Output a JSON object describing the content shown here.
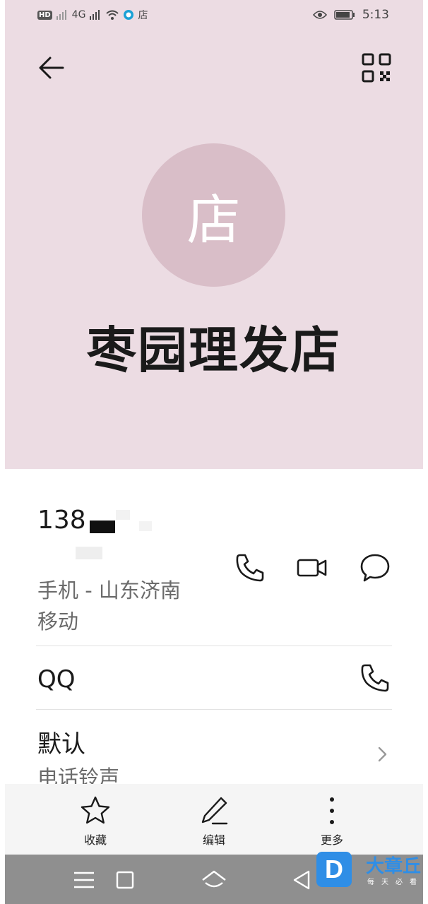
{
  "status_bar": {
    "hd_badge": "HD",
    "network": "4G",
    "notification_char": "店",
    "time": "5:13"
  },
  "contact": {
    "avatar_char": "店",
    "name": "枣园理发店"
  },
  "phone": {
    "number": "138",
    "type_line1": "手机 - 山东济南",
    "type_line2": "移动"
  },
  "qq": {
    "label": "QQ"
  },
  "ringtone": {
    "title": "默认",
    "subtitle": "电话铃声"
  },
  "bottom_actions": {
    "favorite": "收藏",
    "edit": "编辑",
    "more": "更多"
  },
  "watermark": {
    "logo_letter": "D",
    "title": "大章丘",
    "subtitle": "每天必看"
  },
  "colors": {
    "header_bg": "#ecdce3",
    "avatar_bg": "#d9bec8",
    "navbar_bg": "#8f8f8f",
    "watermark_blue": "#2f8ee6"
  }
}
